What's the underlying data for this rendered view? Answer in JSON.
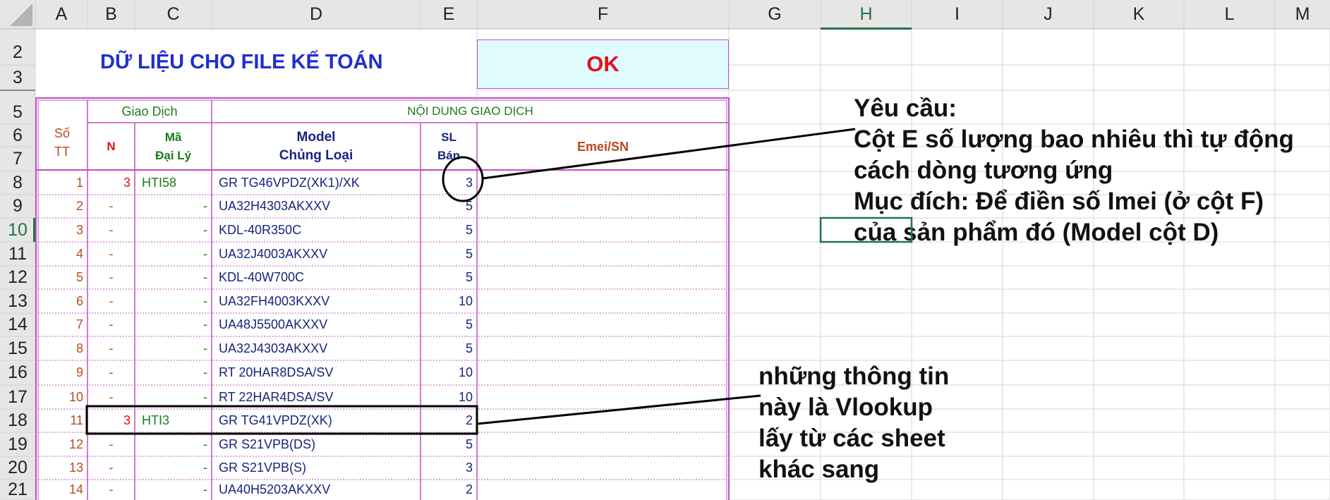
{
  "columns": [
    "A",
    "B",
    "C",
    "D",
    "E",
    "F",
    "G",
    "H",
    "I",
    "J",
    "K",
    "L",
    "M"
  ],
  "selected_column": "H",
  "rows": [
    "2",
    "3",
    "5",
    "6",
    "7",
    "8",
    "9",
    "10",
    "11",
    "12",
    "13",
    "14",
    "15",
    "16",
    "17",
    "18",
    "19",
    "20",
    "21"
  ],
  "selected_row": "10",
  "title": "DỮ LIỆU CHO FILE KẾ TOÁN",
  "ok_label": "OK",
  "headers": {
    "so_tt_line1": "Số",
    "so_tt_line2": "TT",
    "giao_dich": "Giao Dịch",
    "noi_dung": "NỘI DUNG GIAO DỊCH",
    "n": "N",
    "ma_line1": "Mã",
    "ma_line2": "Đại Lý",
    "model_line1": "Model",
    "model_line2": "Chủng Loại",
    "sl_line1": "SL",
    "sl_line2": "Bán",
    "emei": "Emei/SN"
  },
  "data_rows": [
    {
      "tt": "1",
      "n": "3",
      "ma": "HTI58",
      "model": "GR TG46VPDZ(XK1)/XK",
      "sl": "3"
    },
    {
      "tt": "2",
      "n": "-",
      "ma": "-",
      "model": "UA32H4303AKXXV",
      "sl": "5"
    },
    {
      "tt": "3",
      "n": "-",
      "ma": "-",
      "model": "KDL-40R350C",
      "sl": "5"
    },
    {
      "tt": "4",
      "n": "-",
      "ma": "-",
      "model": "UA32J4003AKXXV",
      "sl": "5"
    },
    {
      "tt": "5",
      "n": "-",
      "ma": "-",
      "model": "KDL-40W700C",
      "sl": "5"
    },
    {
      "tt": "6",
      "n": "-",
      "ma": "-",
      "model": "UA32FH4003KXXV",
      "sl": "10"
    },
    {
      "tt": "7",
      "n": "-",
      "ma": "-",
      "model": "UA48J5500AKXXV",
      "sl": "5"
    },
    {
      "tt": "8",
      "n": "-",
      "ma": "-",
      "model": "UA32J4303AKXXV",
      "sl": "5"
    },
    {
      "tt": "9",
      "n": "-",
      "ma": "-",
      "model": "RT 20HAR8DSA/SV",
      "sl": "10"
    },
    {
      "tt": "10",
      "n": "-",
      "ma": "-",
      "model": "RT 22HAR4DSA/SV",
      "sl": "10"
    },
    {
      "tt": "11",
      "n": "3",
      "ma": "HTI3",
      "model": "GR TG41VPDZ(XK)",
      "sl": "2"
    },
    {
      "tt": "12",
      "n": "-",
      "ma": "-",
      "model": "GR S21VPB(DS)",
      "sl": "5"
    },
    {
      "tt": "13",
      "n": "-",
      "ma": "-",
      "model": "GR S21VPB(S)",
      "sl": "3"
    },
    {
      "tt": "14",
      "n": "-",
      "ma": "-",
      "model": "UA40H5203AKXXV",
      "sl": "2"
    }
  ],
  "note_requirement": [
    "Yêu cầu:",
    "Cột E số lượng bao nhiêu thì tự động",
    "cách dòng tương ứng",
    "Mục đích: Để điền số Imei  (ở cột F)",
    "của sản phẩm đó (Model cột D)"
  ],
  "note_vlookup": [
    "những thông tin",
    "này là Vlookup",
    "lấy từ các sheet",
    "khác sang"
  ],
  "colors": {
    "header_bg": "#e6e6e6",
    "gridline": "#d4d4d4",
    "table_border": "#c050c0",
    "title_blue": "#1f2fd0",
    "ok_bg": "#e0fbfd",
    "ok_red": "#e0101f",
    "selection_green": "#217346"
  }
}
